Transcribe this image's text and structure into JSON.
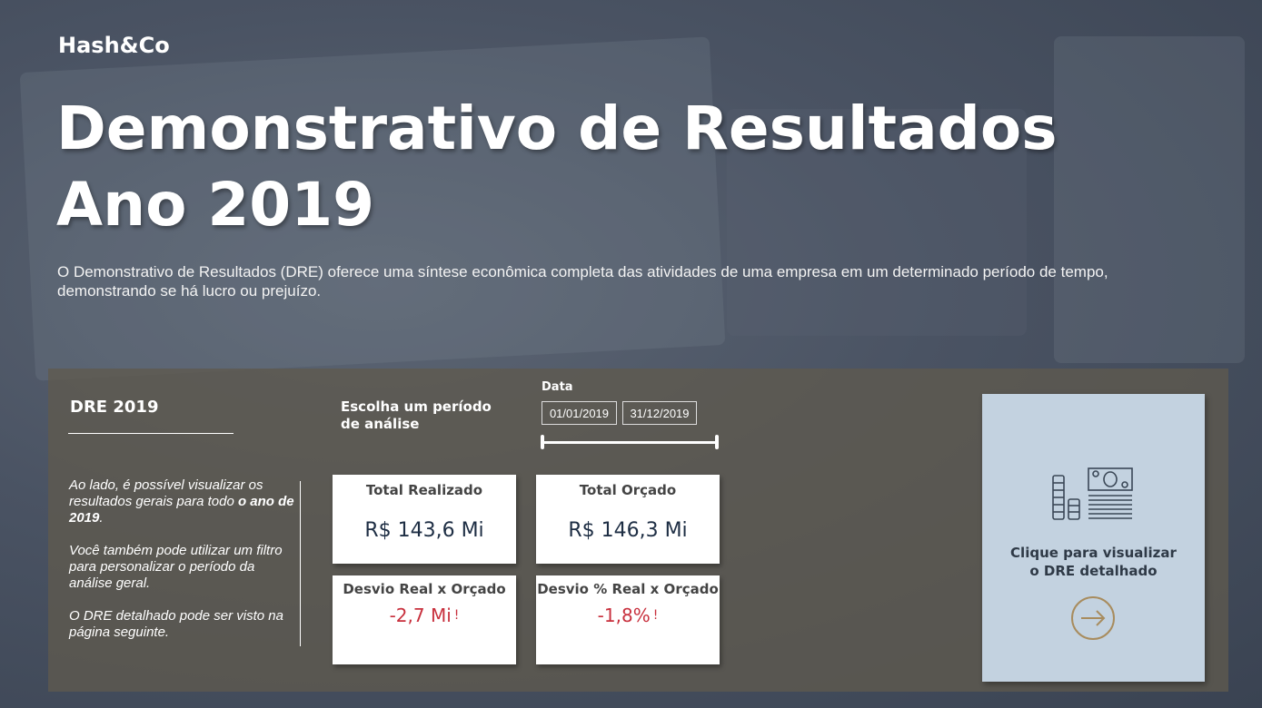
{
  "brand": "Hash&Co",
  "title": {
    "line1": "Demonstrativo de Resultados",
    "line2": "Ano 2019"
  },
  "intro": "O Demonstrativo de Resultados (DRE) oferece uma síntese econômica completa das atividades de uma empresa em um determinado período de tempo, demonstrando se há lucro ou prejuízo.",
  "panel": {
    "heading": "DRE 2019",
    "paragraph1_part1": "Ao lado, é possível visualizar os resultados gerais para todo ",
    "paragraph1_bold": "o ano de 2019",
    "paragraph1_end": ".",
    "paragraph2": "Você também pode utilizar um filtro para personalizar o período da análise geral.",
    "paragraph3": "O DRE detalhado pode ser visto na página seguinte."
  },
  "filter": {
    "prompt": "Escolha um período de análise",
    "label": "Data",
    "start": "01/01/2019",
    "end": "31/12/2019",
    "range_fraction": [
      0,
      1
    ]
  },
  "cards": {
    "realizado": {
      "title": "Total Realizado",
      "value": "R$ 143,6 Mi"
    },
    "orcado": {
      "title": "Total Orçado",
      "value": "R$ 146,3 Mi"
    },
    "desvio": {
      "title": "Desvio Real x Orçado",
      "value": "-2,7 Mi",
      "flag": "!"
    },
    "desvio_pct": {
      "title": "Desvio % Real x Orçado",
      "value": "-1,8%",
      "flag": "!"
    }
  },
  "nav_card": {
    "text_line1": "Clique para visualizar",
    "text_line2": "o DRE detalhado",
    "icon": "money-stack-icon",
    "arrow_icon": "arrow-right-circle-icon"
  },
  "colors": {
    "card_value": "#1e2e44",
    "negative": "#c8303d",
    "nav_card_bg": "#c3d2e0",
    "arrow": "#a88c5e"
  }
}
